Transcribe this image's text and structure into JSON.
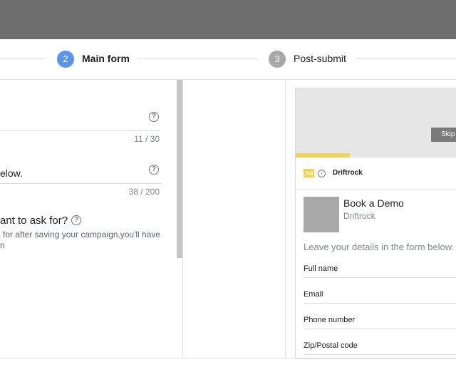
{
  "stepper": {
    "steps": [
      {
        "number": "2",
        "label": "Main form",
        "state": "active"
      },
      {
        "number": "3",
        "label": "Post-submit",
        "state": "inactive"
      }
    ]
  },
  "form": {
    "field1": {
      "counter": "11 / 30"
    },
    "field2": {
      "text": "elow.",
      "counter": "38 / 200"
    },
    "question": {
      "text": "ant to ask for?",
      "description_line1": "for after saving your campaign,you'll have",
      "description_line2": "n"
    }
  },
  "preview": {
    "skip_label": "Skip A",
    "ad_badge": "Ad",
    "advertiser": "Driftrock",
    "card_title": "Book a Demo",
    "card_subtitle": "Driftrock",
    "card_description": "Leave your details in the form below.",
    "fields": [
      "Full name",
      "Email",
      "Phone number",
      "Zip/Postal code"
    ]
  },
  "colors": {
    "active_step": "#5a93ea",
    "inactive_step": "#a8a8a8",
    "ad_yellow": "#f1d35b",
    "header": "#6e6e6e"
  }
}
